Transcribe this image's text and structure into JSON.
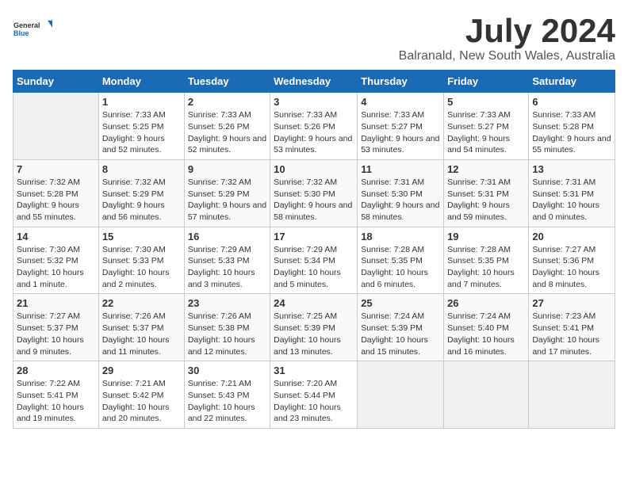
{
  "logo": {
    "general": "General",
    "blue": "Blue"
  },
  "header": {
    "title": "July 2024",
    "subtitle": "Balranald, New South Wales, Australia"
  },
  "days_of_week": [
    "Sunday",
    "Monday",
    "Tuesday",
    "Wednesday",
    "Thursday",
    "Friday",
    "Saturday"
  ],
  "weeks": [
    [
      {
        "day": "",
        "sunrise": "",
        "sunset": "",
        "daylight": ""
      },
      {
        "day": "1",
        "sunrise": "Sunrise: 7:33 AM",
        "sunset": "Sunset: 5:25 PM",
        "daylight": "Daylight: 9 hours and 52 minutes."
      },
      {
        "day": "2",
        "sunrise": "Sunrise: 7:33 AM",
        "sunset": "Sunset: 5:26 PM",
        "daylight": "Daylight: 9 hours and 52 minutes."
      },
      {
        "day": "3",
        "sunrise": "Sunrise: 7:33 AM",
        "sunset": "Sunset: 5:26 PM",
        "daylight": "Daylight: 9 hours and 53 minutes."
      },
      {
        "day": "4",
        "sunrise": "Sunrise: 7:33 AM",
        "sunset": "Sunset: 5:27 PM",
        "daylight": "Daylight: 9 hours and 53 minutes."
      },
      {
        "day": "5",
        "sunrise": "Sunrise: 7:33 AM",
        "sunset": "Sunset: 5:27 PM",
        "daylight": "Daylight: 9 hours and 54 minutes."
      },
      {
        "day": "6",
        "sunrise": "Sunrise: 7:33 AM",
        "sunset": "Sunset: 5:28 PM",
        "daylight": "Daylight: 9 hours and 55 minutes."
      }
    ],
    [
      {
        "day": "7",
        "sunrise": "Sunrise: 7:32 AM",
        "sunset": "Sunset: 5:28 PM",
        "daylight": "Daylight: 9 hours and 55 minutes."
      },
      {
        "day": "8",
        "sunrise": "Sunrise: 7:32 AM",
        "sunset": "Sunset: 5:29 PM",
        "daylight": "Daylight: 9 hours and 56 minutes."
      },
      {
        "day": "9",
        "sunrise": "Sunrise: 7:32 AM",
        "sunset": "Sunset: 5:29 PM",
        "daylight": "Daylight: 9 hours and 57 minutes."
      },
      {
        "day": "10",
        "sunrise": "Sunrise: 7:32 AM",
        "sunset": "Sunset: 5:30 PM",
        "daylight": "Daylight: 9 hours and 58 minutes."
      },
      {
        "day": "11",
        "sunrise": "Sunrise: 7:31 AM",
        "sunset": "Sunset: 5:30 PM",
        "daylight": "Daylight: 9 hours and 58 minutes."
      },
      {
        "day": "12",
        "sunrise": "Sunrise: 7:31 AM",
        "sunset": "Sunset: 5:31 PM",
        "daylight": "Daylight: 9 hours and 59 minutes."
      },
      {
        "day": "13",
        "sunrise": "Sunrise: 7:31 AM",
        "sunset": "Sunset: 5:31 PM",
        "daylight": "Daylight: 10 hours and 0 minutes."
      }
    ],
    [
      {
        "day": "14",
        "sunrise": "Sunrise: 7:30 AM",
        "sunset": "Sunset: 5:32 PM",
        "daylight": "Daylight: 10 hours and 1 minute."
      },
      {
        "day": "15",
        "sunrise": "Sunrise: 7:30 AM",
        "sunset": "Sunset: 5:33 PM",
        "daylight": "Daylight: 10 hours and 2 minutes."
      },
      {
        "day": "16",
        "sunrise": "Sunrise: 7:29 AM",
        "sunset": "Sunset: 5:33 PM",
        "daylight": "Daylight: 10 hours and 3 minutes."
      },
      {
        "day": "17",
        "sunrise": "Sunrise: 7:29 AM",
        "sunset": "Sunset: 5:34 PM",
        "daylight": "Daylight: 10 hours and 5 minutes."
      },
      {
        "day": "18",
        "sunrise": "Sunrise: 7:28 AM",
        "sunset": "Sunset: 5:35 PM",
        "daylight": "Daylight: 10 hours and 6 minutes."
      },
      {
        "day": "19",
        "sunrise": "Sunrise: 7:28 AM",
        "sunset": "Sunset: 5:35 PM",
        "daylight": "Daylight: 10 hours and 7 minutes."
      },
      {
        "day": "20",
        "sunrise": "Sunrise: 7:27 AM",
        "sunset": "Sunset: 5:36 PM",
        "daylight": "Daylight: 10 hours and 8 minutes."
      }
    ],
    [
      {
        "day": "21",
        "sunrise": "Sunrise: 7:27 AM",
        "sunset": "Sunset: 5:37 PM",
        "daylight": "Daylight: 10 hours and 9 minutes."
      },
      {
        "day": "22",
        "sunrise": "Sunrise: 7:26 AM",
        "sunset": "Sunset: 5:37 PM",
        "daylight": "Daylight: 10 hours and 11 minutes."
      },
      {
        "day": "23",
        "sunrise": "Sunrise: 7:26 AM",
        "sunset": "Sunset: 5:38 PM",
        "daylight": "Daylight: 10 hours and 12 minutes."
      },
      {
        "day": "24",
        "sunrise": "Sunrise: 7:25 AM",
        "sunset": "Sunset: 5:39 PM",
        "daylight": "Daylight: 10 hours and 13 minutes."
      },
      {
        "day": "25",
        "sunrise": "Sunrise: 7:24 AM",
        "sunset": "Sunset: 5:39 PM",
        "daylight": "Daylight: 10 hours and 15 minutes."
      },
      {
        "day": "26",
        "sunrise": "Sunrise: 7:24 AM",
        "sunset": "Sunset: 5:40 PM",
        "daylight": "Daylight: 10 hours and 16 minutes."
      },
      {
        "day": "27",
        "sunrise": "Sunrise: 7:23 AM",
        "sunset": "Sunset: 5:41 PM",
        "daylight": "Daylight: 10 hours and 17 minutes."
      }
    ],
    [
      {
        "day": "28",
        "sunrise": "Sunrise: 7:22 AM",
        "sunset": "Sunset: 5:41 PM",
        "daylight": "Daylight: 10 hours and 19 minutes."
      },
      {
        "day": "29",
        "sunrise": "Sunrise: 7:21 AM",
        "sunset": "Sunset: 5:42 PM",
        "daylight": "Daylight: 10 hours and 20 minutes."
      },
      {
        "day": "30",
        "sunrise": "Sunrise: 7:21 AM",
        "sunset": "Sunset: 5:43 PM",
        "daylight": "Daylight: 10 hours and 22 minutes."
      },
      {
        "day": "31",
        "sunrise": "Sunrise: 7:20 AM",
        "sunset": "Sunset: 5:44 PM",
        "daylight": "Daylight: 10 hours and 23 minutes."
      },
      {
        "day": "",
        "sunrise": "",
        "sunset": "",
        "daylight": ""
      },
      {
        "day": "",
        "sunrise": "",
        "sunset": "",
        "daylight": ""
      },
      {
        "day": "",
        "sunrise": "",
        "sunset": "",
        "daylight": ""
      }
    ]
  ]
}
